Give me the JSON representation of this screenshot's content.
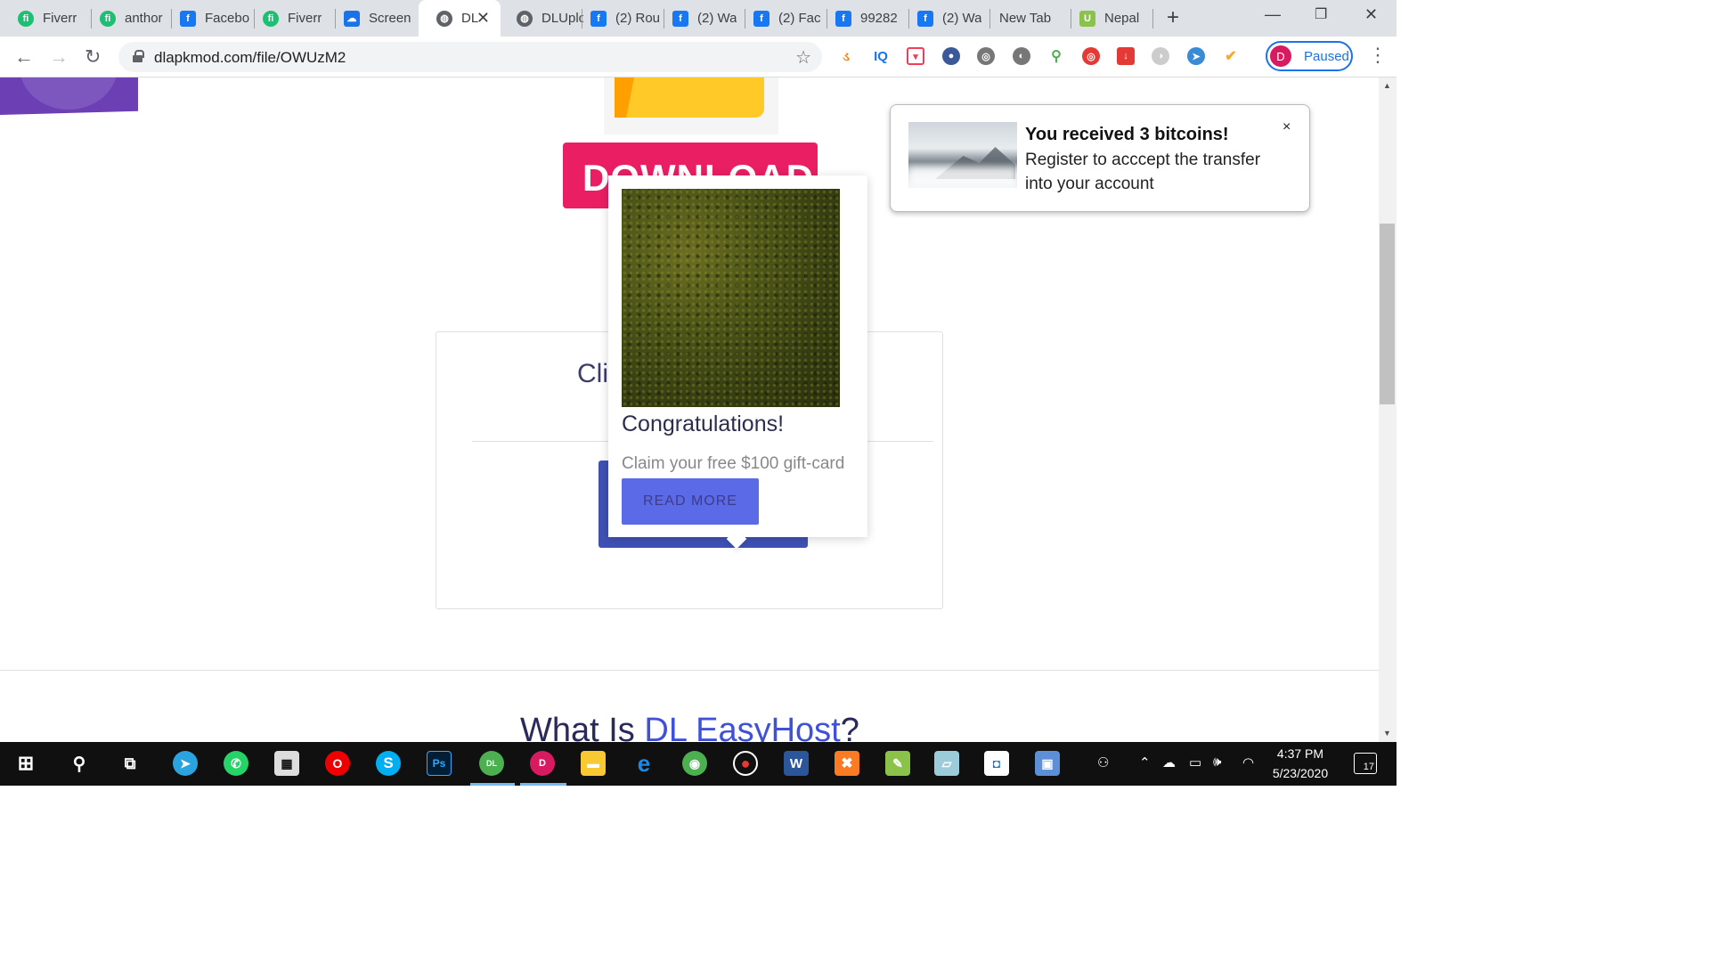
{
  "browser": {
    "tabs": [
      {
        "title": "Fiverr",
        "favicon": "fiverr-icon"
      },
      {
        "title": "anthor",
        "favicon": "fiverr-icon"
      },
      {
        "title": "Facebo",
        "favicon": "facebook-icon"
      },
      {
        "title": "Fiverr",
        "favicon": "fiverr-icon"
      },
      {
        "title": "Screen",
        "favicon": "cloud-icon"
      },
      {
        "title": "DL",
        "favicon": "globe-icon",
        "active": true
      },
      {
        "title": "DLUplo",
        "favicon": "globe-icon"
      },
      {
        "title": "(2) Rou",
        "favicon": "facebook-icon"
      },
      {
        "title": "(2) Wa",
        "favicon": "facebook-icon"
      },
      {
        "title": "(2) Fac",
        "favicon": "facebook-icon"
      },
      {
        "title": "99282",
        "favicon": "facebook-icon"
      },
      {
        "title": "(2) Wa",
        "favicon": "facebook-icon"
      },
      {
        "title": "New Tab",
        "favicon": ""
      },
      {
        "title": "Nepal",
        "favicon": "u-icon"
      }
    ],
    "url": "dlapkmod.com/file/OWUzM2",
    "profile_initial": "D",
    "profile_status": "Paused",
    "extensions": [
      "so-icon",
      "iq-icon",
      "pocket-icon",
      "user-shield-icon",
      "globe-grid-icon",
      "gray-circle-icon",
      "search-ext-icon",
      "target-icon",
      "download-arrow-icon",
      "moon-icon",
      "compass-icon",
      "person-check-icon"
    ]
  },
  "page": {
    "download_label": "DOWNLOAD",
    "card_title_partial": "Cli",
    "section_heading_prefix": "What Is ",
    "section_heading_accent": "DL EasyHost",
    "section_heading_suffix": "?"
  },
  "popup_ad": {
    "title": "Congratulations!",
    "text": "Claim your free $100 gift-card",
    "button": "READ MORE"
  },
  "notification": {
    "title": "You received 3 bitcoins!",
    "text": "Register to acccept the transfer into your account",
    "close": "×"
  },
  "taskbar": {
    "time": "4:37 PM",
    "date": "5/23/2020",
    "notification_count": "17",
    "pinned": [
      "windows-start-icon",
      "search-icon",
      "task-view-icon",
      "telegram-icon",
      "whatsapp-icon",
      "calculator-icon",
      "opera-icon",
      "skype-icon",
      "photoshop-icon",
      "chrome-profile-dl-icon",
      "chrome-profile-d-icon",
      "file-explorer-icon",
      "edge-icon",
      "chrome-icon",
      "recorder-icon",
      "word-icon",
      "xampp-icon",
      "image-editor-icon",
      "notes-icon",
      "box-app-icon",
      "remote-desktop-icon"
    ]
  },
  "colors": {
    "download_button": "#e91e63",
    "popup_button": "#5b6ae6",
    "card_button": "#3f51b5",
    "heading_accent": "#3f51d8",
    "profile_ring": "#1a73e8"
  }
}
